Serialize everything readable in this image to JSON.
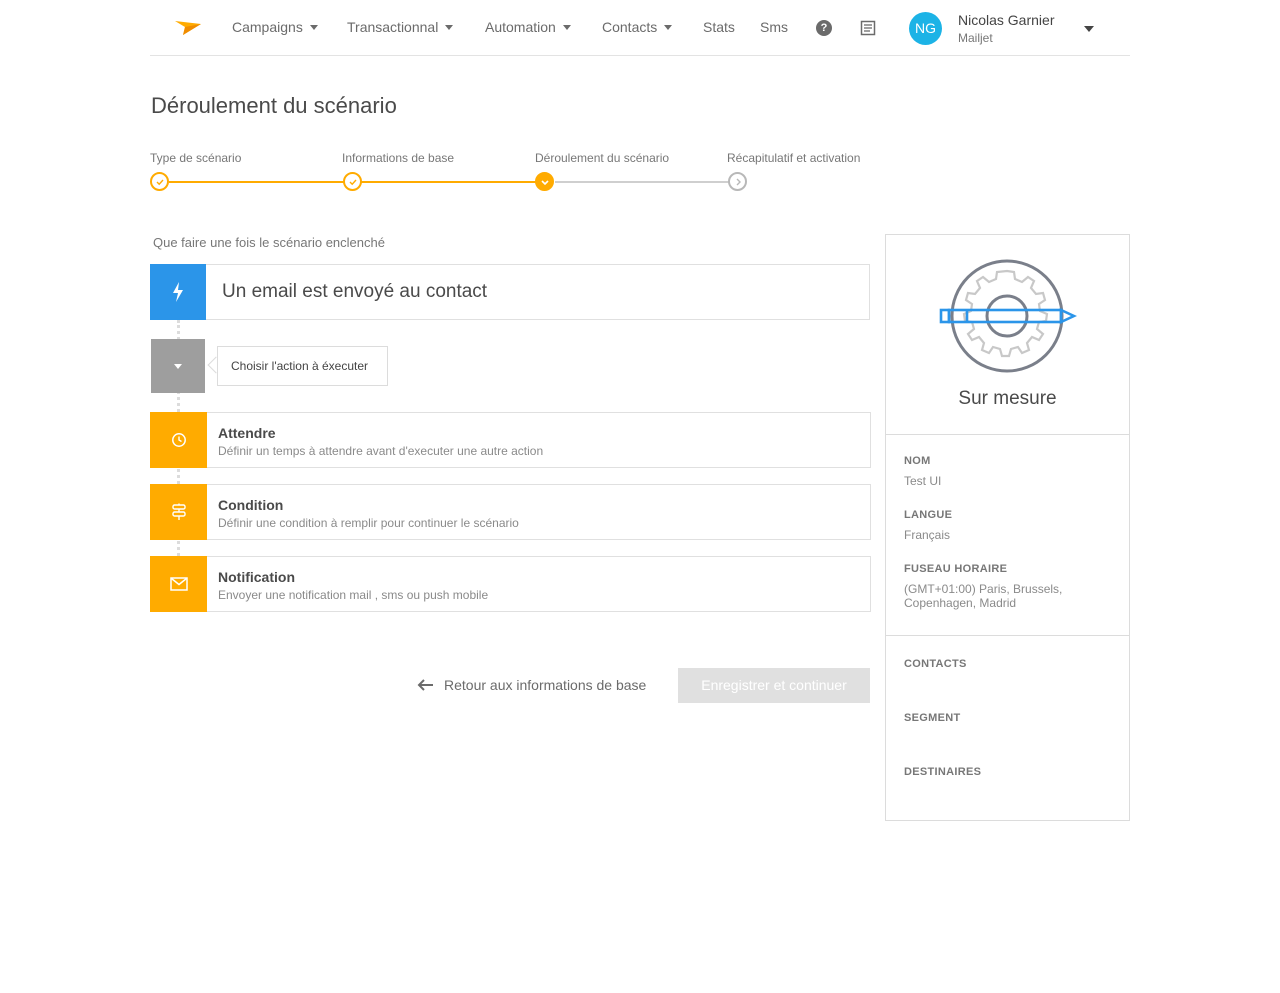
{
  "nav": {
    "items": [
      {
        "label": "Campaigns",
        "has_dropdown": true
      },
      {
        "label": "Transactionnal",
        "has_dropdown": true
      },
      {
        "label": "Automation",
        "has_dropdown": true
      },
      {
        "label": "Contacts",
        "has_dropdown": true
      },
      {
        "label": "Stats",
        "has_dropdown": false
      },
      {
        "label": "Sms",
        "has_dropdown": false
      }
    ],
    "help_icon": "?",
    "doc_icon": "document-icon",
    "user": {
      "initials": "NG",
      "name": "Nicolas Garnier",
      "org": "Mailjet"
    }
  },
  "page": {
    "title": "Déroulement du scénario"
  },
  "stepper": {
    "steps": [
      {
        "label": "Type de scénario",
        "state": "done"
      },
      {
        "label": "Informations de base",
        "state": "done"
      },
      {
        "label": "Déroulement du scénario",
        "state": "current"
      },
      {
        "label": "Récapitulatif et activation",
        "state": "future"
      }
    ]
  },
  "scenario": {
    "section_label": "Que faire une fois le scénario enclenché",
    "trigger": {
      "text": "Un email est envoyé au contact",
      "icon": "lightning-icon"
    },
    "choose_action": "Choisir l'action à éxecuter",
    "actions": [
      {
        "title": "Attendre",
        "description": "Définir un temps à attendre avant d'executer une autre action",
        "icon": "clock-icon"
      },
      {
        "title": "Condition",
        "description": "Définir une condition à remplir pour continuer le scénario",
        "icon": "signpost-icon"
      },
      {
        "title": "Notification",
        "description": "Envoyer une notification mail , sms ou push mobile",
        "icon": "envelope-icon"
      }
    ]
  },
  "footer": {
    "back_label": "Retour aux informations de base",
    "continue_label": "Enregistrer et continuer"
  },
  "side_panel": {
    "title": "Sur mesure",
    "fields": [
      {
        "label": "NOM",
        "value": "Test UI"
      },
      {
        "label": "LANGUE",
        "value": "Français"
      },
      {
        "label": "FUSEAU HORAIRE",
        "value_line1": "(GMT+01:00) Paris, Brussels,",
        "value_line2": "Copenhagen, Madrid"
      }
    ],
    "stats": [
      "CONTACTS",
      "SEGMENT",
      "DESTINAIRES"
    ]
  },
  "colors": {
    "accent": "#ffab00",
    "trigger_blue": "#2b95e9",
    "avatar": "#1cb3e6",
    "disabled_button": "#e0e0e0"
  }
}
